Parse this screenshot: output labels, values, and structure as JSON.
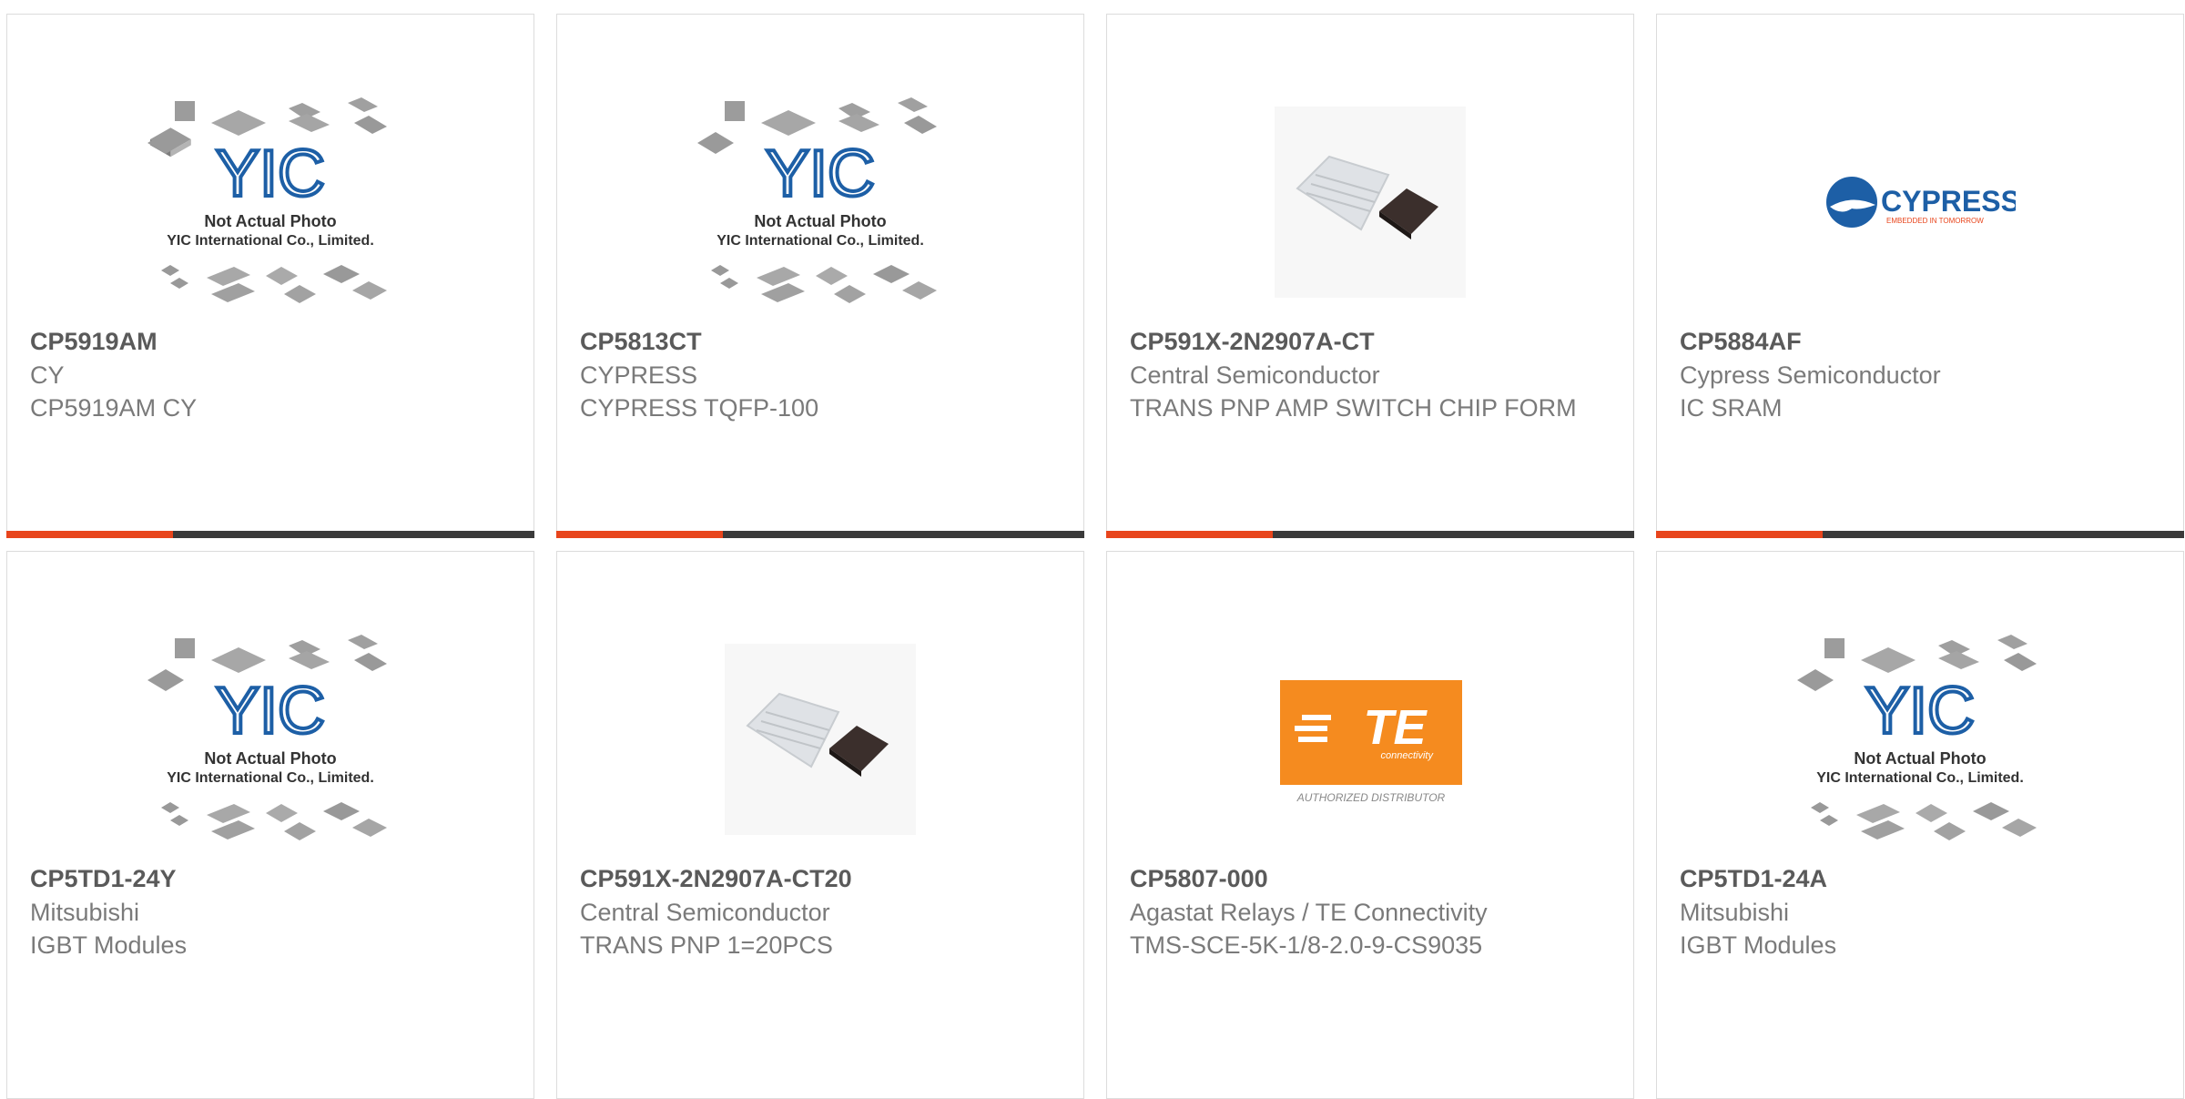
{
  "products": [
    {
      "part": "CP5919AM",
      "maker": "CY",
      "desc": "CP5919AM CY",
      "image": "placeholder-not-actual-photo"
    },
    {
      "part": "CP5813CT",
      "maker": "CYPRESS",
      "desc": "CYPRESS TQFP-100",
      "image": "placeholder-not-actual-photo"
    },
    {
      "part": "CP591X-2N2907A-CT",
      "maker": "Central Semiconductor",
      "desc": "TRANS PNP AMP SWITCH CHIP FORM",
      "image": "chip-photo"
    },
    {
      "part": "CP5884AF",
      "maker": "Cypress Semiconductor",
      "desc": "IC SRAM",
      "image": "cypress-logo"
    },
    {
      "part": "CP5TD1-24Y",
      "maker": "Mitsubishi",
      "desc": "IGBT Modules",
      "image": "placeholder-not-actual-photo"
    },
    {
      "part": "CP591X-2N2907A-CT20",
      "maker": "Central Semiconductor",
      "desc": "TRANS PNP 1=20PCS",
      "image": "chip-photo"
    },
    {
      "part": "CP5807-000",
      "maker": "Agastat Relays / TE Connectivity",
      "desc": "TMS-SCE-5K-1/8-2.0-9-CS9035",
      "image": "te-logo"
    },
    {
      "part": "CP5TD1-24A",
      "maker": "Mitsubishi",
      "desc": "IGBT Modules",
      "image": "placeholder-not-actual-photo"
    }
  ],
  "placeholder": {
    "line1": "Not Actual Photo",
    "line2": "YIC International Co., Limited.",
    "brand": "YIC"
  },
  "cypress_logo": {
    "name": "CYPRESS",
    "tagline": "EMBEDDED IN TOMORROW"
  },
  "te_logo": {
    "name": "TE",
    "sub": "connectivity",
    "caption": "AUTHORIZED DISTRIBUTOR"
  },
  "colors": {
    "accent": "#e8451c",
    "bar": "#3a3a3a",
    "border": "#dcdcdc",
    "text": "#7a7a7a",
    "cypress_blue": "#1d5fa6",
    "te_orange": "#f58b1f"
  }
}
